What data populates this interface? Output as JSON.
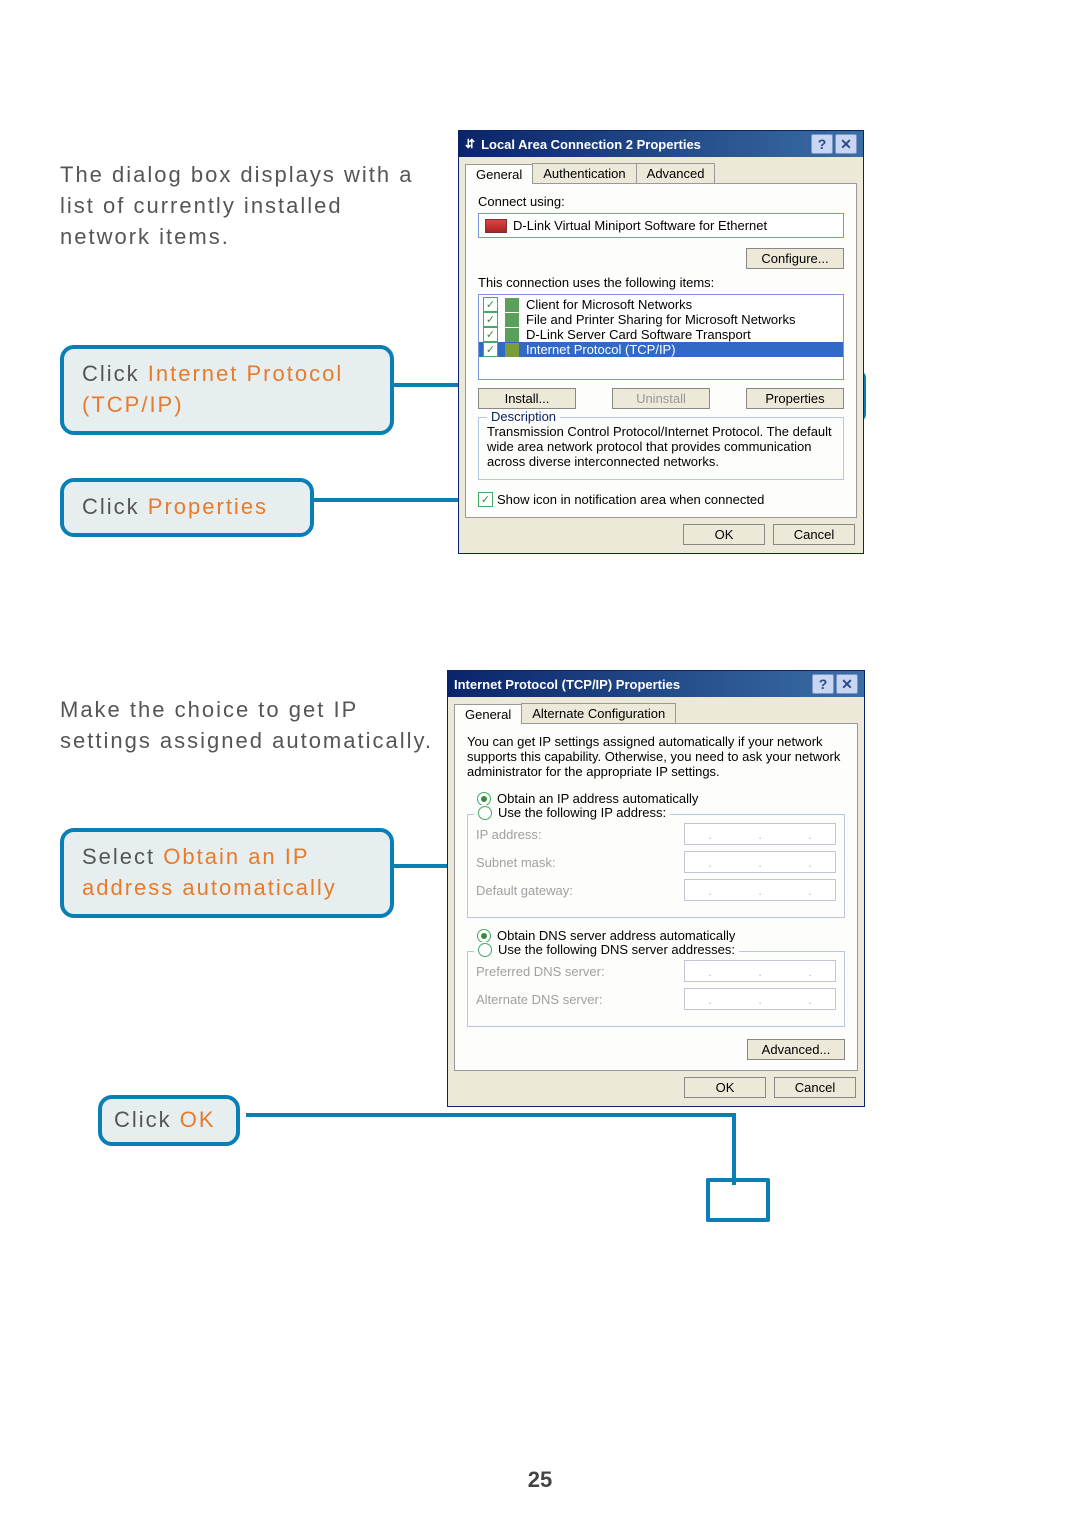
{
  "instructions": {
    "p1": "The dialog box displays with a list of currently installed network items.",
    "p2": "Make the choice to get IP settings assigned automatically."
  },
  "callouts": {
    "c1_prefix": "Click",
    "c1_orange": " Internet Protocol (TCP/IP)",
    "c2_prefix": "Click",
    "c2_orange": " Properties",
    "c3_prefix": "Select",
    "c3_orange": " Obtain an IP address automatically",
    "c4_prefix": "Click",
    "c4_orange": " OK"
  },
  "dialog1": {
    "title": "Local Area Connection 2 Properties",
    "tabs": [
      "General",
      "Authentication",
      "Advanced"
    ],
    "connect_using_label": "Connect using:",
    "adapter": "D-Link Virtual Miniport Software for Ethernet",
    "configure_btn": "Configure...",
    "items_label": "This connection uses the following items:",
    "items": [
      "Client for Microsoft Networks",
      "File and Printer Sharing for Microsoft Networks",
      "D-Link Server Card Software Transport",
      "Internet Protocol (TCP/IP)"
    ],
    "install_btn": "Install...",
    "uninstall_btn": "Uninstall",
    "properties_btn": "Properties",
    "desc_legend": "Description",
    "desc_text": "Transmission Control Protocol/Internet Protocol. The default wide area network protocol that provides communication across diverse interconnected networks.",
    "show_icon": "Show icon in notification area when connected",
    "ok": "OK",
    "cancel": "Cancel"
  },
  "dialog2": {
    "title": "Internet Protocol (TCP/IP) Properties",
    "tabs": [
      "General",
      "Alternate Configuration"
    ],
    "intro": "You can get IP settings assigned automatically if your network supports this capability. Otherwise, you need to ask your network administrator for the appropriate IP settings.",
    "opt_auto_ip": "Obtain an IP address automatically",
    "opt_use_ip": "Use the following IP address:",
    "ip_address": "IP address:",
    "subnet": "Subnet mask:",
    "gateway": "Default gateway:",
    "opt_auto_dns": "Obtain DNS server address automatically",
    "opt_use_dns": "Use the following DNS server addresses:",
    "pref_dns": "Preferred DNS server:",
    "alt_dns": "Alternate DNS server:",
    "advanced": "Advanced...",
    "ok": "OK",
    "cancel": "Cancel"
  },
  "page_number": "25"
}
